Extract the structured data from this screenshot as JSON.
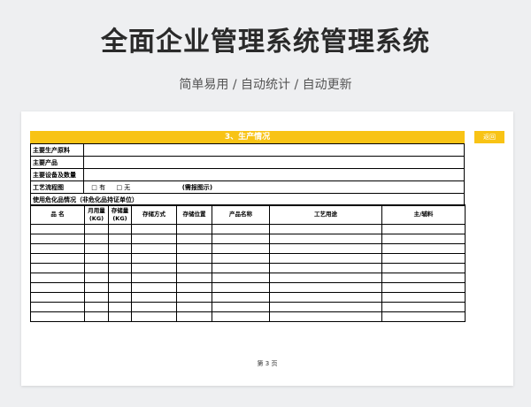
{
  "header": {
    "title": "全面企业管理系统管理系统",
    "subtitle": "简单易用 / 自动统计 / 自动更新"
  },
  "paper": {
    "return_label": "返回",
    "section_title": "3、生产情况",
    "fields": {
      "raw_material": "主要生产原料",
      "main_product": "主要产品",
      "main_equipment": "主要设备及数量",
      "process_flow": "工艺流程图",
      "process_opt_yes": "□ 有",
      "process_opt_no": "□ 无",
      "process_note": "(需报图示)",
      "hazardous": "使用危化品情况（非危化品持证单位）"
    },
    "grid": {
      "headers": [
        "品  名",
        "月用量 (KG)",
        "存储量 (KG)",
        "存储方式",
        "存储位置",
        "产品名称",
        "工艺用途",
        "主/辅料"
      ],
      "row_count": 10
    },
    "page_number": "第 3 页"
  },
  "colors": {
    "accent": "#f8c315",
    "background": "#eeeff1"
  }
}
